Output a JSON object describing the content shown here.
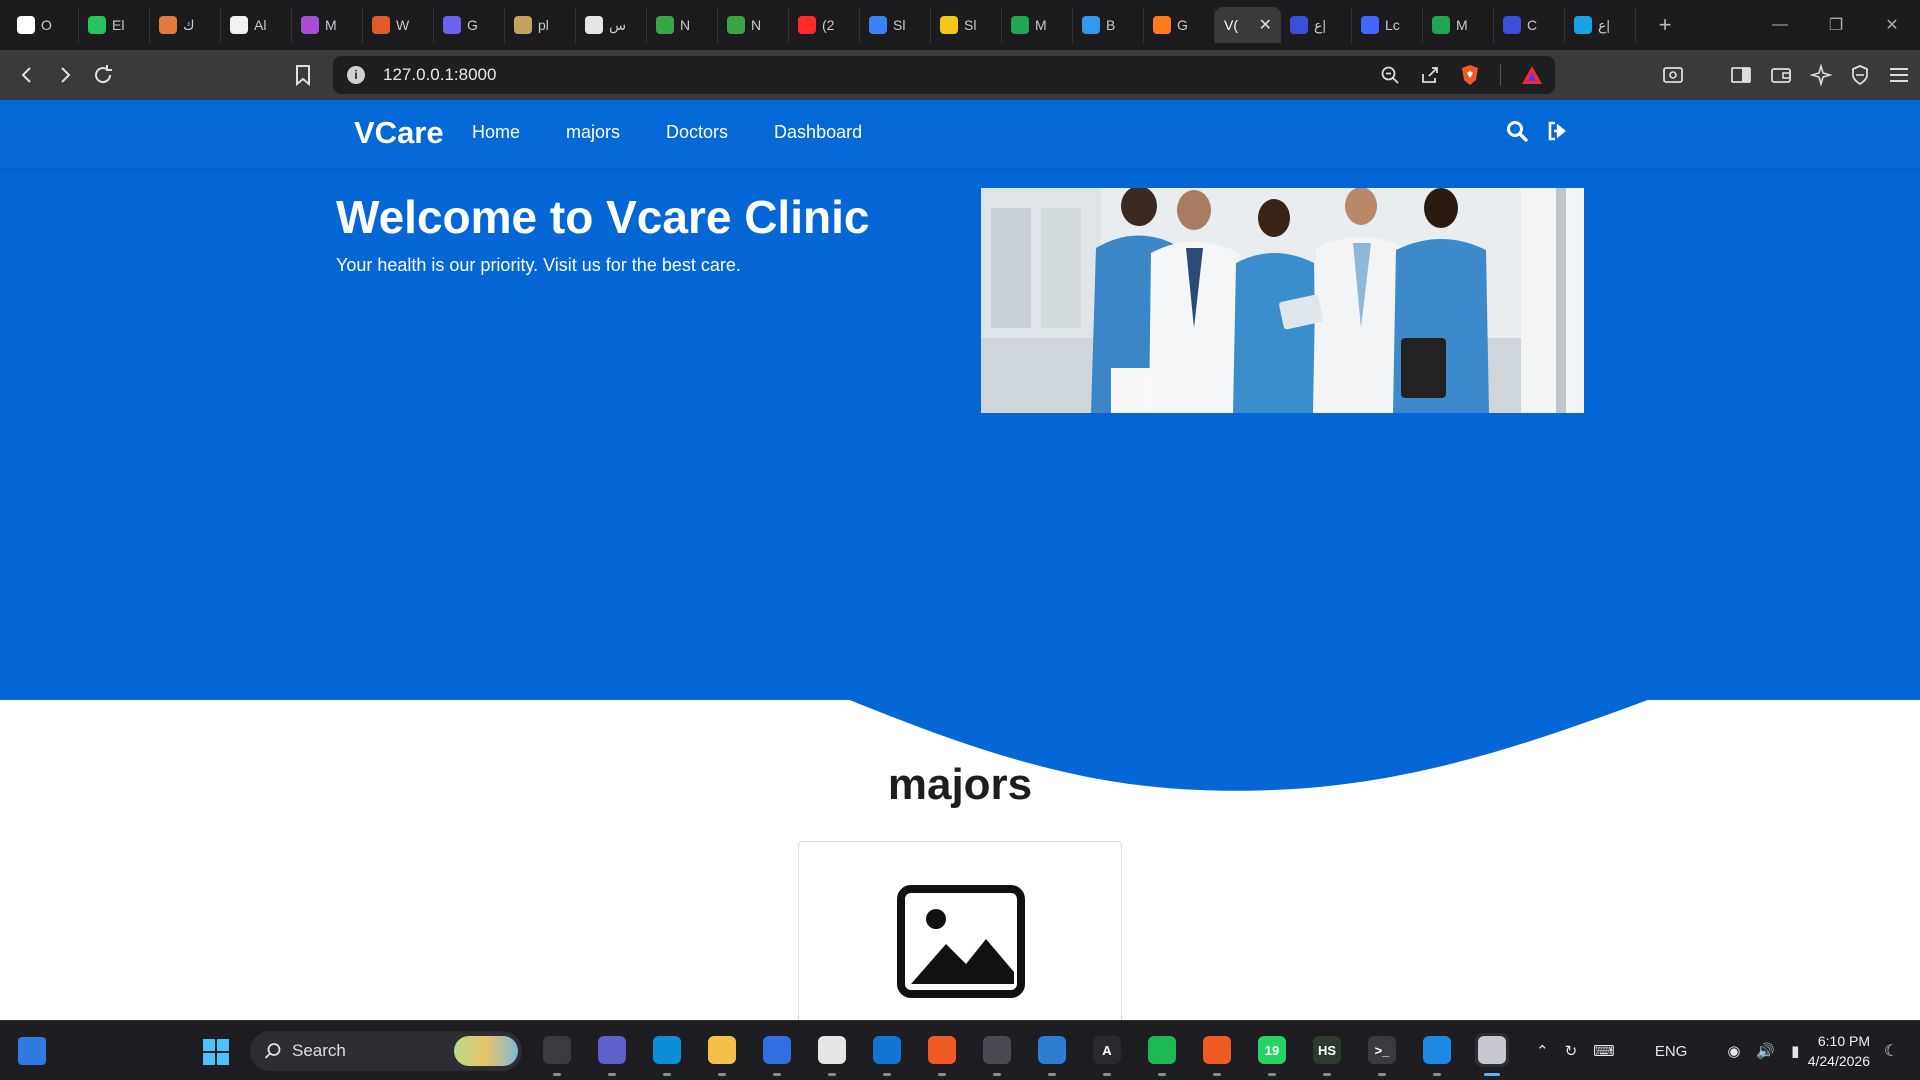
{
  "browser": {
    "tabs": [
      {
        "label": "O",
        "color": "#ffffff"
      },
      {
        "label": "El",
        "color": "#22c55e"
      },
      {
        "label": "ك",
        "color": "#e07a3f"
      },
      {
        "label": "Al",
        "color": "#f2f2f2"
      },
      {
        "label": "M",
        "color": "#a84dd6"
      },
      {
        "label": "W",
        "color": "#e25a2a"
      },
      {
        "label": "G",
        "color": "#6b63f0"
      },
      {
        "label": "pl",
        "color": "#c6a15b"
      },
      {
        "label": "س",
        "color": "#e6e6e6"
      },
      {
        "label": "N",
        "color": "#3aa547"
      },
      {
        "label": "N",
        "color": "#3aa547"
      },
      {
        "label": "(2",
        "color": "#ff2a2a"
      },
      {
        "label": "Sl",
        "color": "#3b82f6"
      },
      {
        "label": "Sl",
        "color": "#f5c518"
      },
      {
        "label": "M",
        "color": "#1ea84f"
      },
      {
        "label": "B",
        "color": "#2f9af2"
      },
      {
        "label": "G",
        "color": "#ff7a1a"
      }
    ],
    "active_tab": {
      "label": "V(",
      "close": "✕"
    },
    "tabs_after": [
      {
        "label": "ع|",
        "color": "#3b4fd8"
      },
      {
        "label": "Lc",
        "color": "#4466ff"
      },
      {
        "label": "M",
        "color": "#1ea84f"
      },
      {
        "label": "C",
        "color": "#3b4fd8"
      },
      {
        "label": "ع|",
        "color": "#19a3e6"
      }
    ],
    "new_tab": "+",
    "url": "127.0.0.1:8000"
  },
  "site": {
    "brand": "VCare",
    "nav": [
      "Home",
      "majors",
      "Doctors",
      "Dashboard"
    ],
    "hero_title": "Welcome to Vcare Clinic",
    "hero_subtitle": "Your health is our priority. Visit us for the best care.",
    "section_title": "majors"
  },
  "colors": {
    "primary": "#0567d5",
    "nav": "#0468d6"
  },
  "taskbar": {
    "search_label": "Search",
    "apps": [
      {
        "name": "task-view",
        "color": "#3a3a40",
        "label": ""
      },
      {
        "name": "meet",
        "color": "#5b5fc7",
        "label": ""
      },
      {
        "name": "edge",
        "color": "#0c8fd6",
        "label": ""
      },
      {
        "name": "explorer",
        "color": "#f5c04a",
        "label": ""
      },
      {
        "name": "store",
        "color": "#2f6fe0",
        "label": ""
      },
      {
        "name": "chrome",
        "color": "#e6e6e6",
        "label": ""
      },
      {
        "name": "outlook",
        "color": "#1173d4",
        "label": ""
      },
      {
        "name": "brave",
        "color": "#f15a24",
        "label": ""
      },
      {
        "name": "app-gray",
        "color": "#4a4a52",
        "label": ""
      },
      {
        "name": "app-blue",
        "color": "#2d7fd1",
        "label": ""
      },
      {
        "name": "arc",
        "color": "#2a2a30",
        "label": "A"
      },
      {
        "name": "spotify",
        "color": "#1db954",
        "label": ""
      },
      {
        "name": "postman",
        "color": "#ef5b25",
        "label": ""
      },
      {
        "name": "whatsapp",
        "color": "#25d366",
        "label": "19"
      },
      {
        "name": "hs",
        "color": "#2f3a2f",
        "label": "HS"
      },
      {
        "name": "terminal",
        "color": "#3a3a40",
        "label": ">_"
      },
      {
        "name": "vscode",
        "color": "#1e88e5",
        "label": ""
      },
      {
        "name": "snipping",
        "color": "#c8c8d0",
        "label": ""
      }
    ],
    "lang": "ENG",
    "time": "6:10 PM",
    "date": "4/24/2026"
  }
}
